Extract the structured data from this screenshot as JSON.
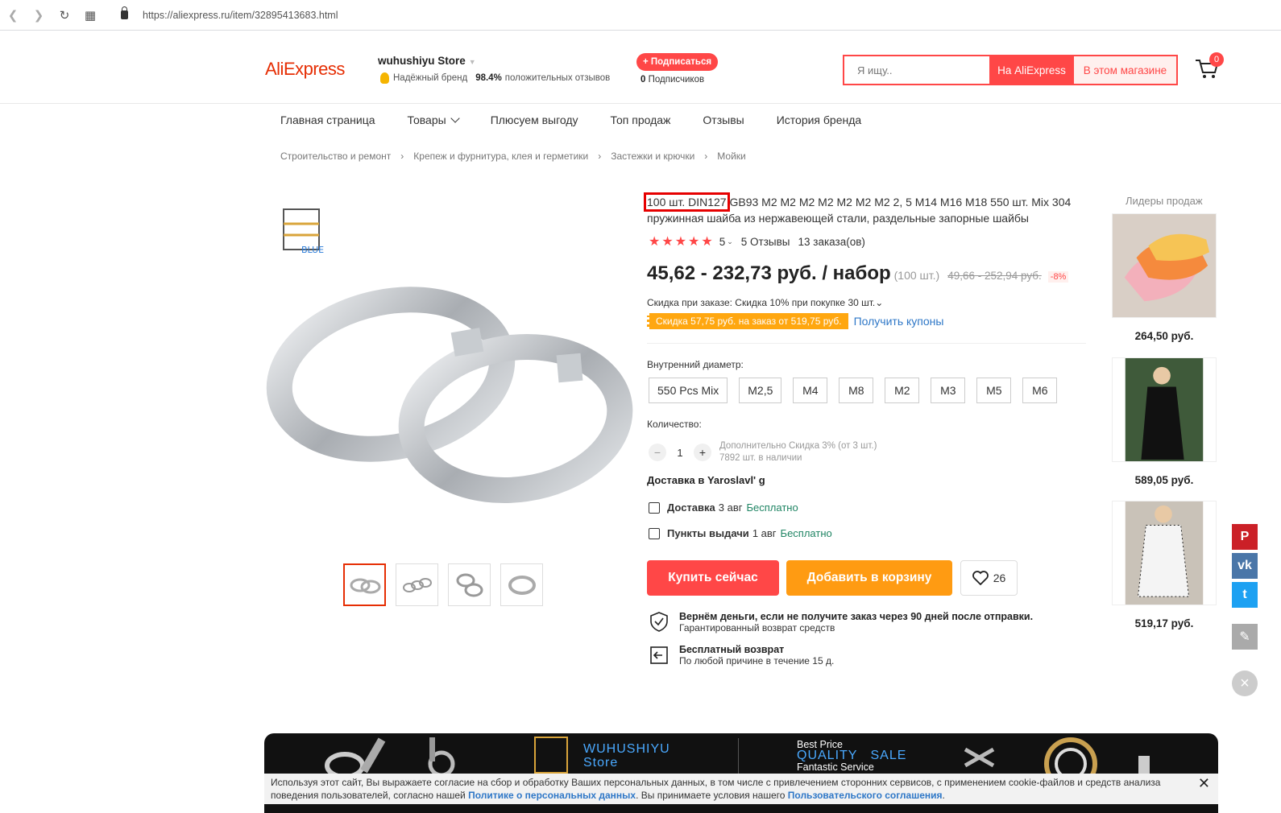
{
  "browser": {
    "url": "https://aliexpress.ru/item/32895413683.html"
  },
  "header": {
    "logo": "AliExpress",
    "store_name": "wuhushiyu Store",
    "brand_label": "Надёжный бренд",
    "positive_pct": "98.4%",
    "positive_label": "положительных отзывов",
    "subscribe_label": "+ Подписаться",
    "subscribers_count": "0",
    "subscribers_label": "Подписчиков",
    "search_placeholder": "Я ищу..",
    "search_btn_all": "На AliExpress",
    "search_btn_store": "В этом магазине",
    "cart_count": "0"
  },
  "menu": [
    "Главная страница",
    "Товары",
    "Плюсуем выгоду",
    "Топ продаж",
    "Отзывы",
    "История бренда"
  ],
  "breadcrumbs": [
    "Строительство и ремонт",
    "Крепеж и фурнитура, клея и герметики",
    "Застежки и крючки",
    "Мойки"
  ],
  "product": {
    "title_highlight": "100 шт. DIN127",
    "title_rest": " GB93 M2 M2 M2 M2 M2 M2 M2 2, 5 M14 M16 M18 550 шт. Mix 304 пружинная шайба из нержавеющей стали, раздельные запорные шайбы",
    "stars": "★★★★★",
    "rating": "5",
    "reviews": "5 Отзывы",
    "orders": "13 заказа(ов)",
    "price": "45,62 - 232,73 руб. / набор",
    "price_unit": "(100 шт.)",
    "old_price": "49,66 - 252,94 руб.",
    "discount_pct": "-8%",
    "order_discount": "Скидка при заказе: Скидка 10% при покупке 30 шт.",
    "coupon_tag": "Скидка 57,75 руб. на заказ от 519,75 руб.",
    "coupon_link": "Получить купоны",
    "diameter_label": "Внутренний диаметр:",
    "sizes": [
      "550 Pcs Mix",
      "M2,5",
      "M4",
      "M8",
      "M2",
      "M3",
      "M5",
      "M6"
    ],
    "quantity_label": "Количество:",
    "quantity": "1",
    "qty_note1": "Дополнительно Скидка 3% (от 3 шт.)",
    "qty_note2": "7892 шт. в наличии",
    "delivery_title": "Доставка в Yaroslavl' g",
    "ship1_label": "Доставка",
    "ship1_date": "3 авг",
    "ship1_price": "Бесплатно",
    "ship2_label": "Пункты выдачи",
    "ship2_date": "1 авг",
    "ship2_price": "Бесплатно",
    "buy_now": "Купить сейчас",
    "add_to_cart": "Добавить в корзину",
    "wish_count": "26",
    "guarantee1_title": "Вернём деньги, если не получите заказ через 90 дней после отправки.",
    "guarantee1_sub": "Гарантированный возврат средств",
    "guarantee2_title": "Бесплатный возврат",
    "guarantee2_sub": "По любой причине в течение 15 д."
  },
  "leaders": {
    "title": "Лидеры продаж",
    "items": [
      {
        "price": "264,50 руб."
      },
      {
        "price": "589,05 руб."
      },
      {
        "price": "519,17 руб."
      }
    ]
  },
  "banner": {
    "store_line1": "WUHUSHIYU",
    "store_line2": "Store",
    "best_price": "Best Price",
    "quality_sale": "QUALITY   SALE",
    "fantastic": "Fantastic Service"
  },
  "cookie": {
    "text1": "Используя этот сайт, Вы выражаете согласие на сбор и обработку Ваших персональных данных, в том числе с привлечением сторонних сервисов, с применением cookie-файлов и средств анализа поведения пользователей, согласно нашей ",
    "link1": "Политике о персональных данных",
    "text2": ". Вы принимаете условия нашего ",
    "link2": "Пользовательского соглашения",
    "text3": "."
  },
  "colors": {
    "brand_red": "#ff4747",
    "orange": "#ff9b12",
    "link_blue": "#2e77c7",
    "green": "#208564"
  }
}
